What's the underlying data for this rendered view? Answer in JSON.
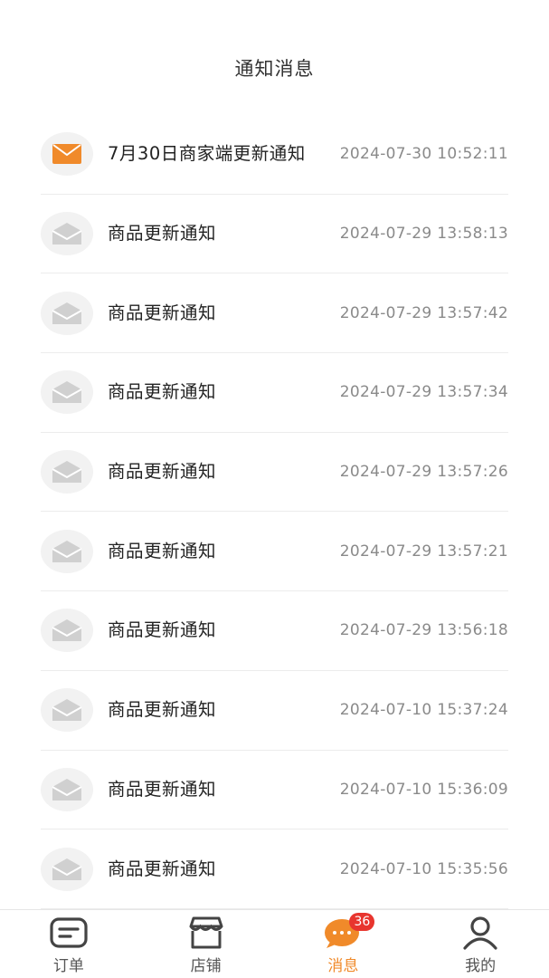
{
  "header": {
    "title": "通知消息"
  },
  "messages": [
    {
      "title": "7月30日商家端更新通知",
      "time": "2024-07-30 10:52:11",
      "unread": true,
      "icon": "envelope-unread-icon"
    },
    {
      "title": "商品更新通知",
      "time": "2024-07-29 13:58:13",
      "unread": false,
      "icon": "envelope-read-icon"
    },
    {
      "title": "商品更新通知",
      "time": "2024-07-29 13:57:42",
      "unread": false,
      "icon": "envelope-read-icon"
    },
    {
      "title": "商品更新通知",
      "time": "2024-07-29 13:57:34",
      "unread": false,
      "icon": "envelope-read-icon"
    },
    {
      "title": "商品更新通知",
      "time": "2024-07-29 13:57:26",
      "unread": false,
      "icon": "envelope-read-icon"
    },
    {
      "title": "商品更新通知",
      "time": "2024-07-29 13:57:21",
      "unread": false,
      "icon": "envelope-read-icon"
    },
    {
      "title": "商品更新通知",
      "time": "2024-07-29 13:56:18",
      "unread": false,
      "icon": "envelope-read-icon"
    },
    {
      "title": "商品更新通知",
      "time": "2024-07-10 15:37:24",
      "unread": false,
      "icon": "envelope-read-icon"
    },
    {
      "title": "商品更新通知",
      "time": "2024-07-10 15:36:09",
      "unread": false,
      "icon": "envelope-read-icon"
    },
    {
      "title": "商品更新通知",
      "time": "2024-07-10 15:35:56",
      "unread": false,
      "icon": "envelope-read-icon"
    }
  ],
  "tabbar": {
    "tabs": [
      {
        "label": "订单",
        "icon": "order-icon",
        "active": false
      },
      {
        "label": "店铺",
        "icon": "store-icon",
        "active": false
      },
      {
        "label": "消息",
        "icon": "message-icon",
        "active": true,
        "badge": "36"
      },
      {
        "label": "我的",
        "icon": "profile-icon",
        "active": false
      }
    ]
  },
  "colors": {
    "accent": "#f08a2a",
    "badge": "#e8352e",
    "text_primary": "#222222",
    "text_secondary": "#8a8a8a",
    "icon_read": "#d0d0d0"
  }
}
